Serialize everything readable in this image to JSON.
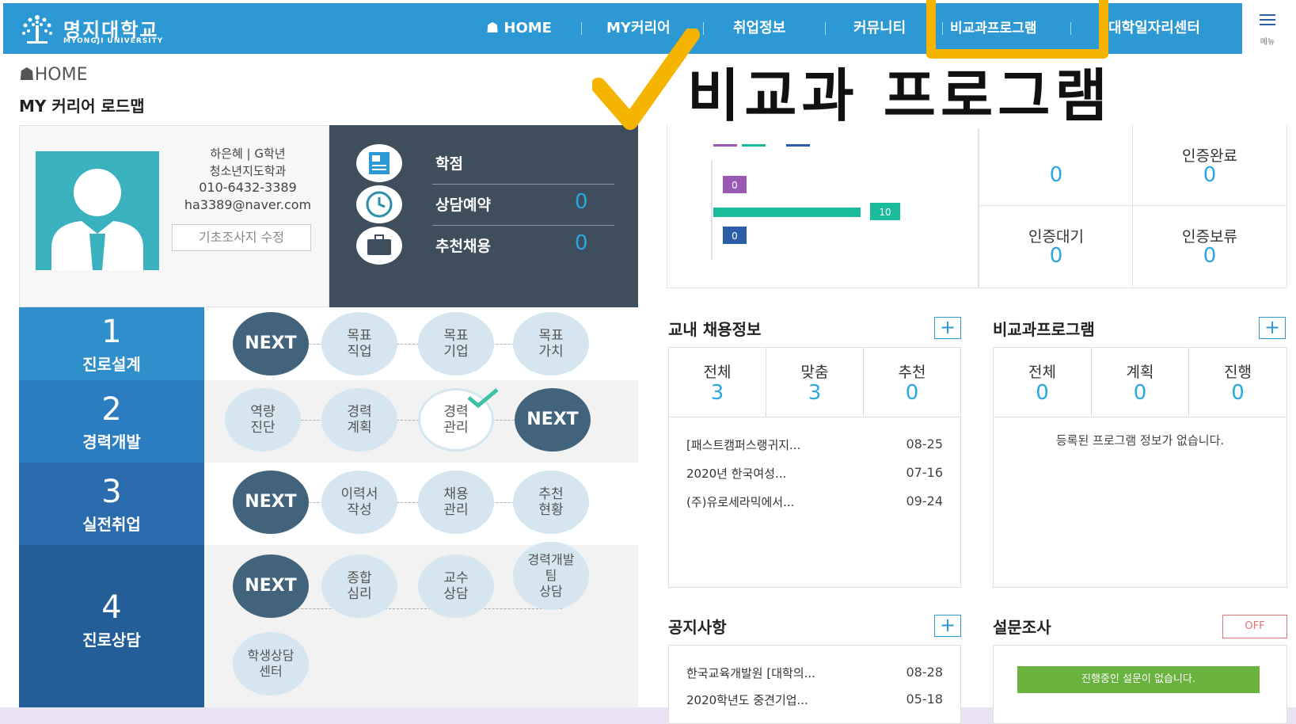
{
  "header": {
    "logo_ko": "명지대학교",
    "logo_en": "MYONGJI UNIVERSITY",
    "nav": [
      "HOME",
      "MY커리어",
      "취업정보",
      "커뮤니티",
      "비교과프로그램",
      "대학일자리센터"
    ],
    "menu_label": "메뉴"
  },
  "overlay": {
    "title": "비교과 프로그램"
  },
  "breadcrumb": "HOME",
  "page_title": "MY 커리어 로드맵",
  "profile": {
    "name_grade": "하은혜 | G학년",
    "dept": "청소년지도학과",
    "phone": "010-6432-3389",
    "email": "ha3389@naver.com",
    "edit_button": "기초조사지 수정"
  },
  "stats": [
    {
      "label": "학점",
      "value": ""
    },
    {
      "label": "상담예약",
      "value": "0"
    },
    {
      "label": "추천채용",
      "value": "0"
    }
  ],
  "roadmap": [
    {
      "num": "1",
      "label": "진로설계",
      "items": [
        "NEXT",
        "목표\n직업",
        "목표\n기업",
        "목표\n가치"
      ]
    },
    {
      "num": "2",
      "label": "경력개발",
      "items": [
        "역량\n진단",
        "경력\n계획",
        "경력\n관리",
        "NEXT"
      ]
    },
    {
      "num": "3",
      "label": "실전취업",
      "items": [
        "NEXT",
        "이력서\n작성",
        "채용\n관리",
        "추천\n현황"
      ]
    },
    {
      "num": "4",
      "label": "진로상담",
      "items": [
        "NEXT",
        "종합\n심리",
        "교수\n상담",
        "경력개발\n팀\n상담",
        "학생상담\n센터"
      ]
    }
  ],
  "chart": {
    "values": [
      "0",
      "10",
      "0"
    ]
  },
  "cert": [
    {
      "label": "",
      "value": "0"
    },
    {
      "label": "인증완료",
      "value": "0"
    },
    {
      "label": "인증대기",
      "value": "0"
    },
    {
      "label": "인증보류",
      "value": "0"
    }
  ],
  "jobs": {
    "title": "교내 채용정보",
    "tabs": [
      {
        "label": "전체",
        "value": "3"
      },
      {
        "label": "맞춤",
        "value": "3"
      },
      {
        "label": "추천",
        "value": "0"
      }
    ],
    "items": [
      {
        "title": "[패스트캠퍼스랭귀지...",
        "date": "08-25"
      },
      {
        "title": "2020년 한국여성...",
        "date": "07-16"
      },
      {
        "title": "(주)유로세라믹에서...",
        "date": "09-24"
      }
    ]
  },
  "programs": {
    "title": "비교과프로그램",
    "tabs": [
      {
        "label": "전체",
        "value": "0"
      },
      {
        "label": "계획",
        "value": "0"
      },
      {
        "label": "진행",
        "value": "0"
      }
    ],
    "empty": "등록된 프로그램 정보가 없습니다."
  },
  "notice": {
    "title": "공지사항",
    "items": [
      {
        "title": "한국교육개발원 [대학의...",
        "date": "08-28"
      },
      {
        "title": "2020학년도 중견기업...",
        "date": "05-18"
      }
    ]
  },
  "survey": {
    "title": "설문조사",
    "toggle": "OFF",
    "empty": "진행중인 설문이 없습니다."
  },
  "colors": {
    "primary": "#2c98d4",
    "highlight": "#f4b400",
    "next": "#41637b",
    "accent": "#2aa6e0"
  }
}
